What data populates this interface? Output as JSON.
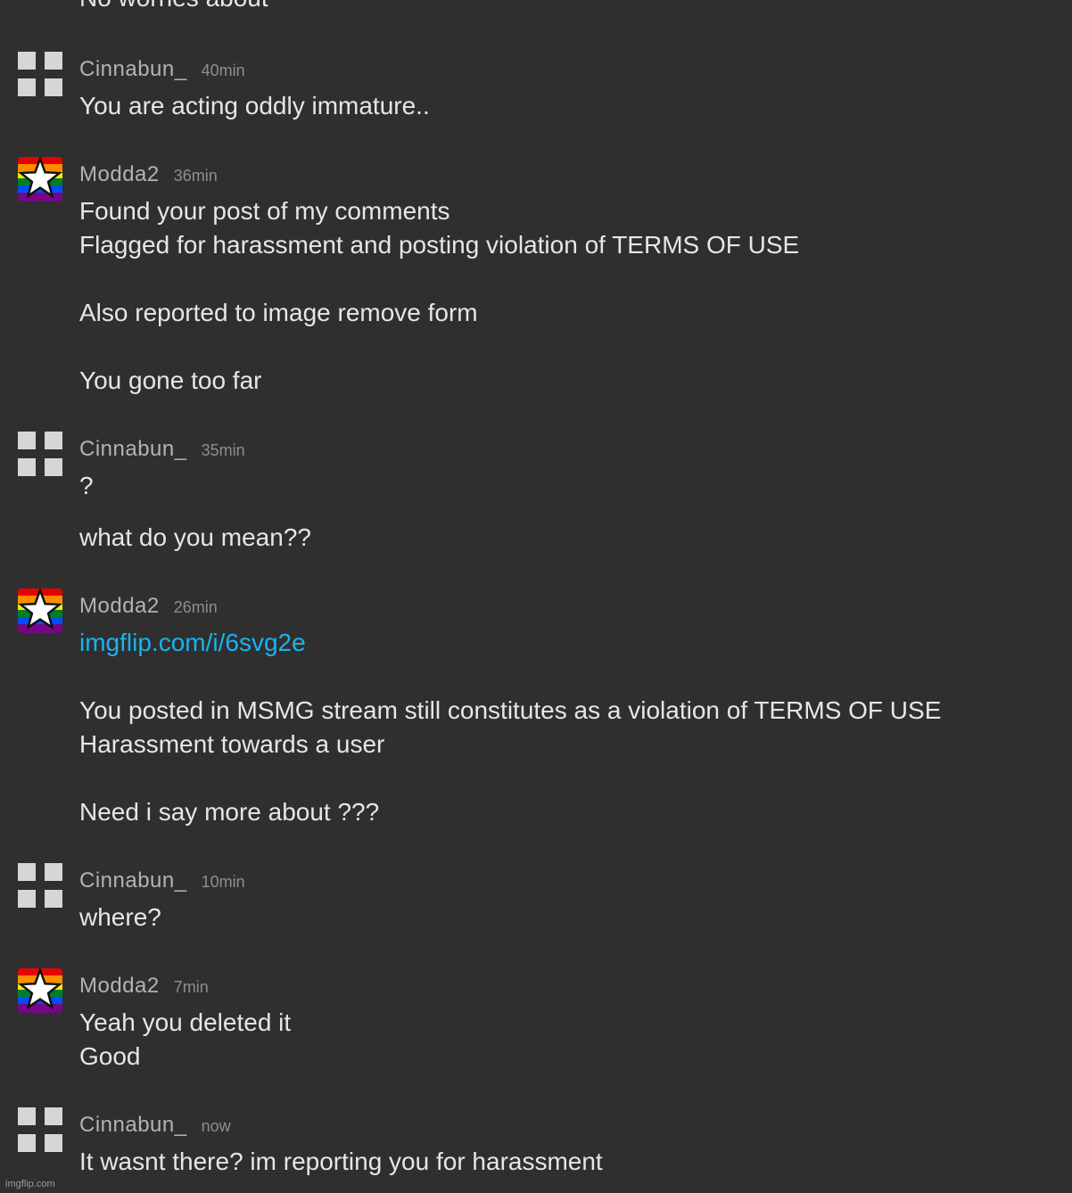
{
  "clipped_top_text": "No worries about",
  "messages": [
    {
      "user": "Cinnabun_",
      "time": "40min",
      "lines": [
        "You are acting oddly immature.."
      ]
    },
    {
      "user": "Modda2",
      "time": "36min",
      "lines": [
        "Found your post of my comments",
        "Flagged for harassment and posting violation of TERMS OF USE",
        "Also reported to image remove form",
        "You gone too far"
      ]
    },
    {
      "user": "Cinnabun_",
      "time": "35min",
      "lines": [
        "?",
        "what do you mean??"
      ]
    },
    {
      "user": "Modda2",
      "time": "26min",
      "link": "imgflip.com/i/6svg2e",
      "lines": [
        "You posted in MSMG stream still constitutes as a violation of TERMS OF USE",
        "Harassment towards a user",
        "Need i say more about ???"
      ]
    },
    {
      "user": "Cinnabun_",
      "time": "10min",
      "lines": [
        "where?"
      ]
    },
    {
      "user": "Modda2",
      "time": "7min",
      "lines": [
        "Yeah you deleted it",
        "Good"
      ]
    },
    {
      "user": "Cinnabun_",
      "time": "now",
      "lines": [
        "It wasnt there? im reporting you for harassment"
      ]
    }
  ],
  "watermark": "imgflip.com",
  "colors": {
    "background": "#2f2f2f",
    "link": "#1ab3f0",
    "username": "#b3b3b3",
    "timestamp": "#8e8e8e",
    "message_text": "#e6e6e6"
  },
  "icons": {
    "cinnabun_avatar": "grid-icon",
    "modda2_avatar": "rainbow-star-icon"
  }
}
